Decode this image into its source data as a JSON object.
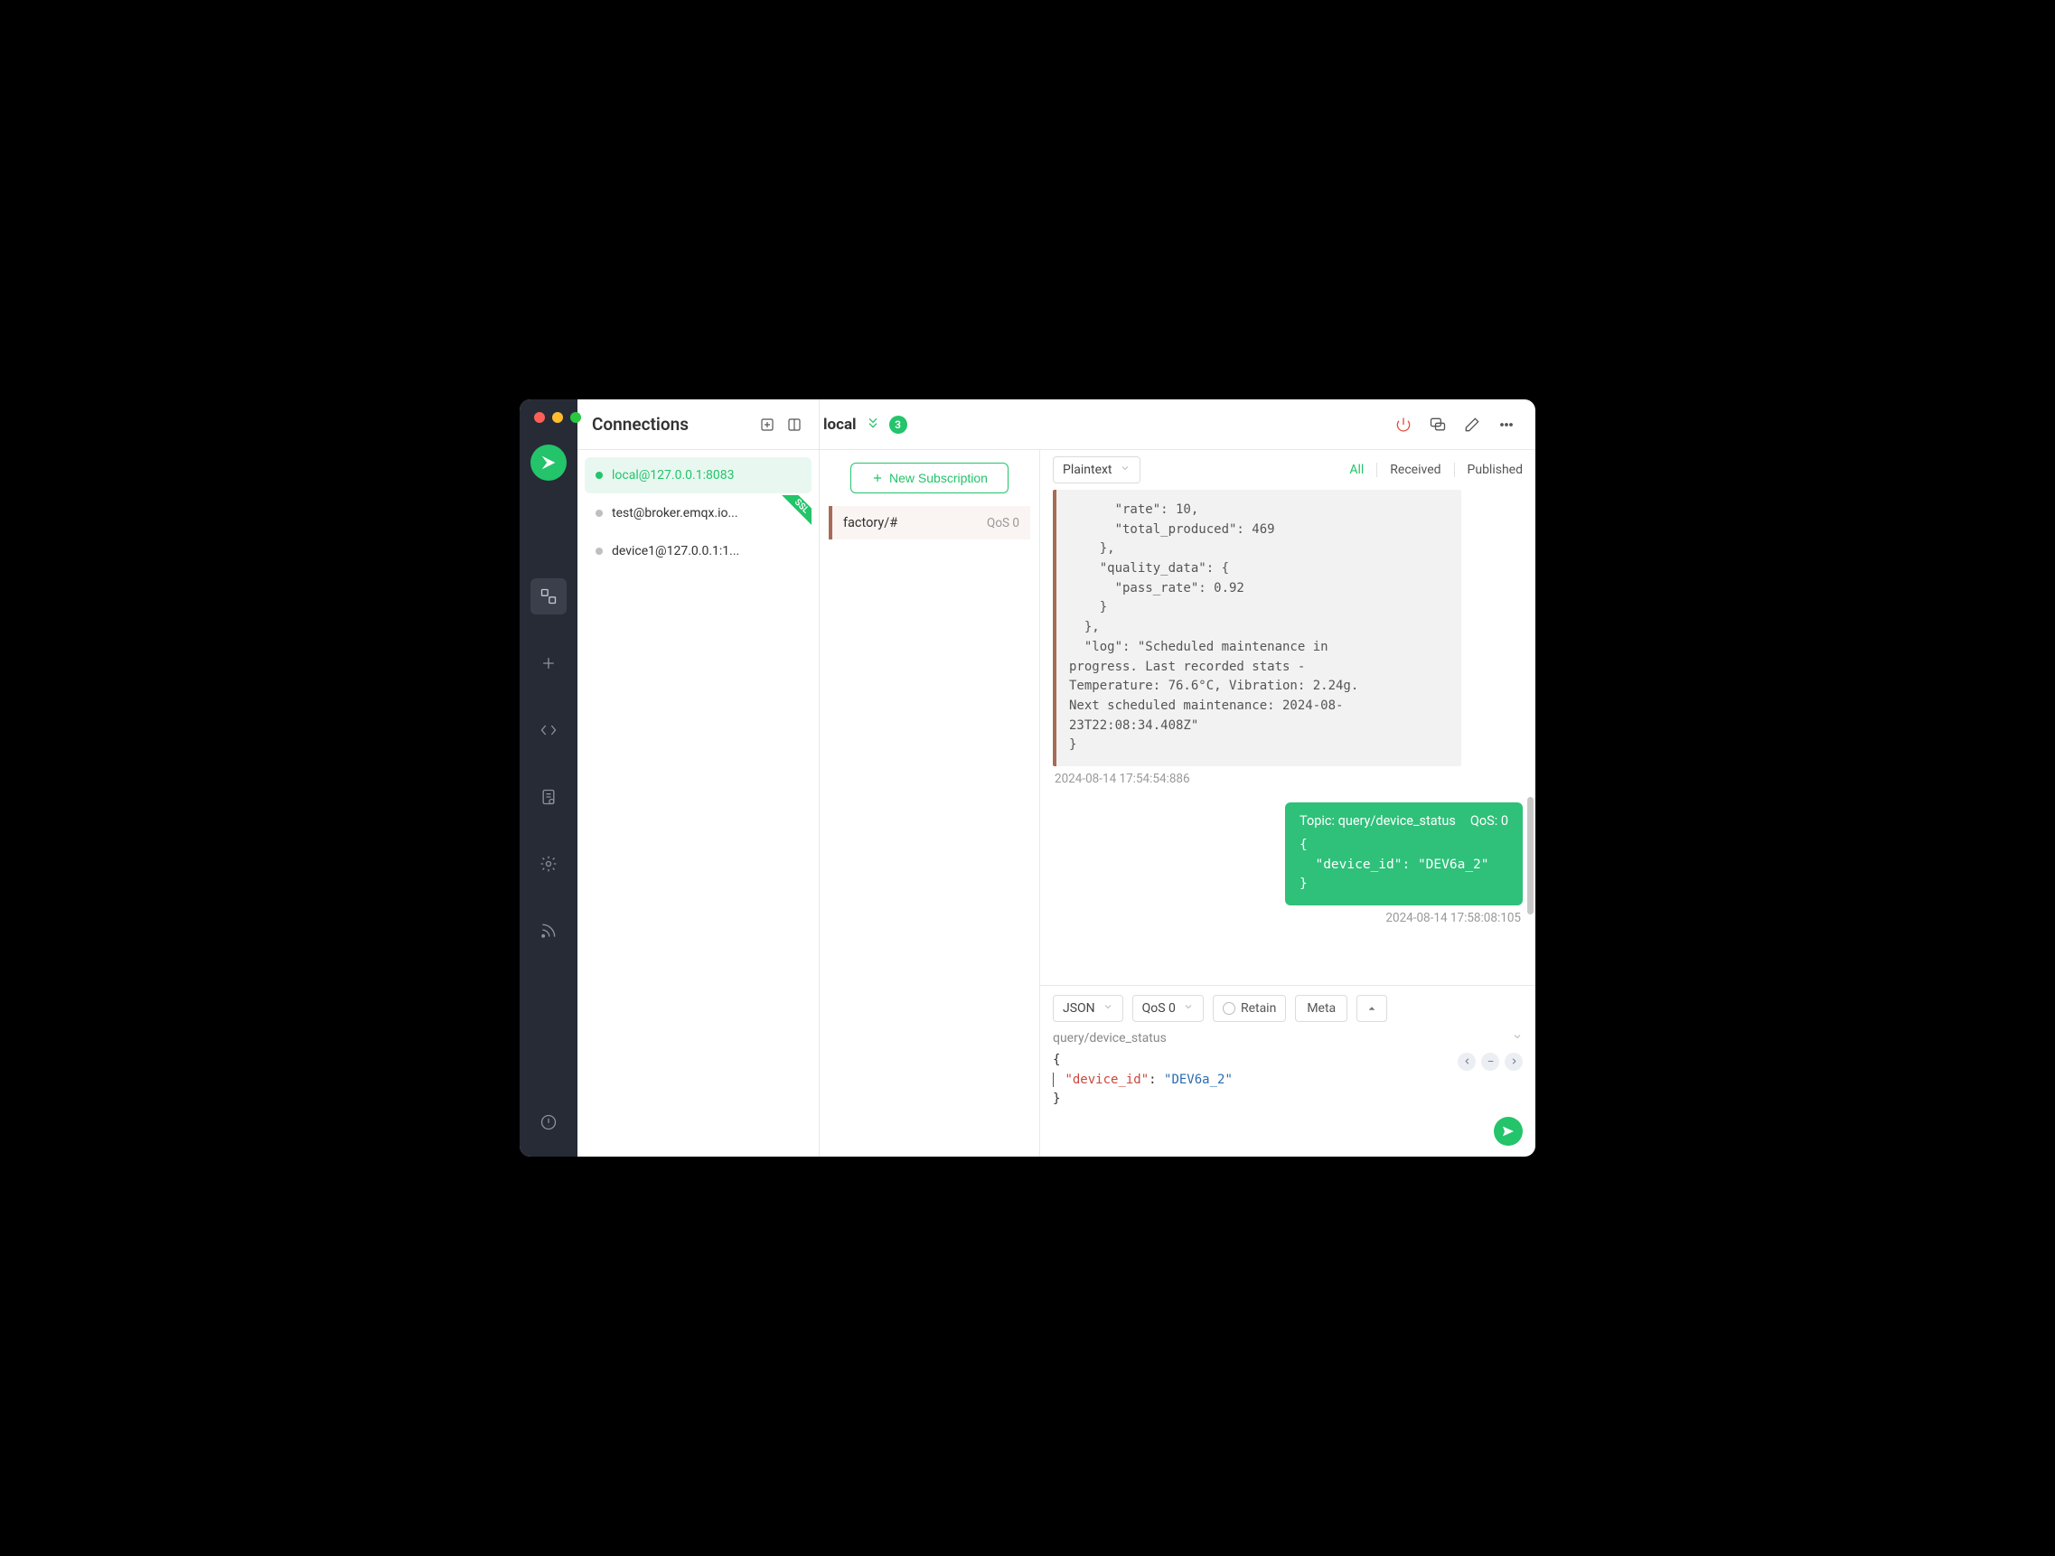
{
  "sidebar_title": "Connections",
  "connections": [
    {
      "label": "local@127.0.0.1:8083",
      "active": true,
      "ssl": false
    },
    {
      "label": "test@broker.emqx.io...",
      "active": false,
      "ssl": true
    },
    {
      "label": "device1@127.0.0.1:1...",
      "active": false,
      "ssl": false
    }
  ],
  "ssl_badge": "SSL",
  "current": {
    "name": "local",
    "sub_count": "3"
  },
  "new_sub_label": "New Subscription",
  "subscriptions": [
    {
      "topic": "factory/#",
      "qos": "QoS 0"
    }
  ],
  "format_sel": "Plaintext",
  "filters": {
    "all": "All",
    "received": "Received",
    "published": "Published"
  },
  "msg_in_body": "      \"rate\": 10,\n      \"total_produced\": 469\n    },\n    \"quality_data\": {\n      \"pass_rate\": 0.92\n    }\n  },\n  \"log\": \"Scheduled maintenance in\nprogress. Last recorded stats -\nTemperature: 76.6°C, Vibration: 2.24g.\nNext scheduled maintenance: 2024-08-\n23T22:08:34.408Z\"\n}",
  "msg_in_ts": "2024-08-14 17:54:54:886",
  "msg_out": {
    "topic_label": "Topic: query/device_status",
    "qos_label": "QoS: 0",
    "body": "{\n  \"device_id\": \"DEV6a_2\"\n}",
    "ts": "2024-08-14 17:58:08:105"
  },
  "composer": {
    "fmt": "JSON",
    "qos": "QoS 0",
    "retain": "Retain",
    "meta": "Meta",
    "topic": "query/device_status",
    "body_open": "{",
    "body_key": "\"device_id\"",
    "body_colon": ": ",
    "body_val": "\"DEV6a_2\"",
    "body_close": "}"
  }
}
